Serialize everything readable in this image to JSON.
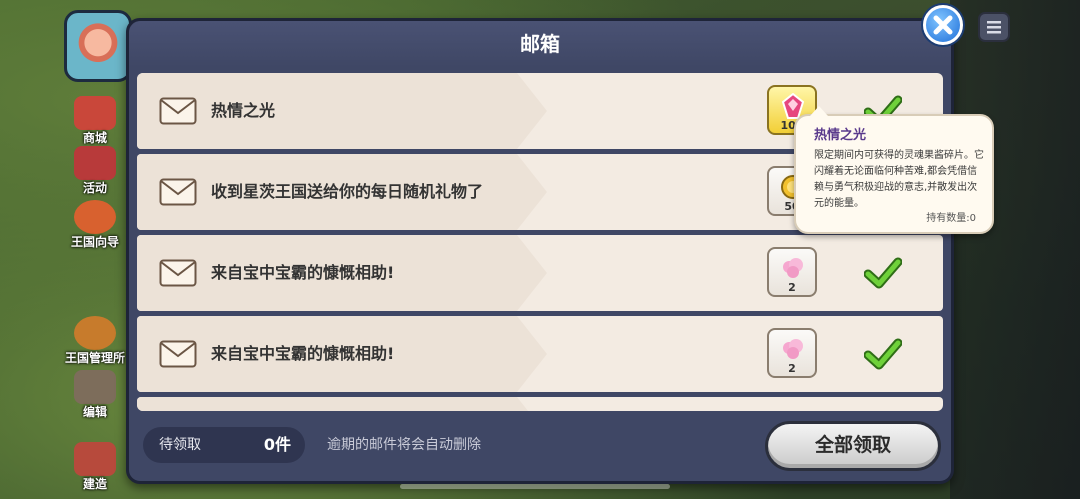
{
  "sidebar": {
    "items": [
      {
        "label": "商城",
        "color": "#c9473a"
      },
      {
        "label": "活动",
        "color": "#b83a3a"
      },
      {
        "label": "王国向导",
        "color": "#d8612f"
      },
      {
        "label": "王国管理所",
        "color": "#c77b2c"
      },
      {
        "label": "编辑",
        "color": "#7d6d5b"
      },
      {
        "label": "建造",
        "color": "#b74a3c"
      }
    ]
  },
  "mailbox": {
    "title": "邮箱",
    "mails": [
      {
        "title": "热情之光",
        "reward_qty": "100",
        "reward_icon": "pink-crystal-icon",
        "claimed": true
      },
      {
        "title": "收到星茨王国送给你的每日随机礼物了",
        "reward_qty": "50",
        "reward_icon": "gold-coin-icon",
        "claimed": true
      },
      {
        "title": "来自宝中宝霸的慷慨相助!",
        "reward_qty": "2",
        "reward_icon": "pink-cotton-icon",
        "claimed": true
      },
      {
        "title": "来自宝中宝霸的慷慨相助!",
        "reward_qty": "2",
        "reward_icon": "pink-cotton-icon",
        "claimed": true
      }
    ],
    "footer": {
      "pending_label": "待领取",
      "pending_count": "0件",
      "expire_note": "逾期的邮件将会自动删除",
      "claim_all_label": "全部领取"
    }
  },
  "tooltip": {
    "title": "热情之光",
    "description": "限定期间内可获得的灵魂果酱碎片。它闪耀着无论面临何种苦难,都会凭借信赖与勇气积极迎战的意志,并散发出次元的能量。",
    "owned": "持有数量:0"
  },
  "colors": {
    "panel": "#3f4765",
    "row": "#f3ebe2",
    "check": "#5cc12a",
    "close": "#1f6fd8"
  }
}
